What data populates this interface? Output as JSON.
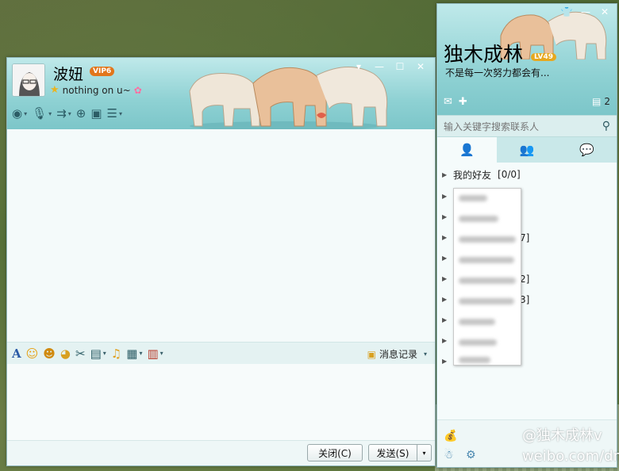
{
  "chat_window": {
    "contact_name": "波妞",
    "vip_badge": "VIP6",
    "status_text": "nothing on u~",
    "window_controls": {
      "menu": "▾",
      "minimize": "—",
      "maximize": "☐",
      "close": "✕"
    },
    "toolbar_icons": [
      "video-call-icon",
      "voice-call-icon",
      "file-transfer-icon",
      "add-contact-icon",
      "screen-share-icon",
      "apps-icon"
    ],
    "format_icons": [
      "font-icon",
      "emoji-icon",
      "magic-emoji-icon",
      "shake-icon",
      "screenshot-icon",
      "image-icon",
      "music-icon",
      "screen-capture-icon",
      "gift-icon"
    ],
    "history_label": "消息记录",
    "close_button": "关闭(C)",
    "send_button": "发送(S)"
  },
  "main_panel": {
    "user_name": "独木成林",
    "level_badge": "LV49",
    "signature": "不是每一次努力都会有...",
    "unread_count": "2",
    "search_placeholder": "输入关键字搜索联系人",
    "tabs": [
      "contacts-tab",
      "groups-tab",
      "recent-tab"
    ],
    "groups": [
      {
        "name": "我的好友",
        "count": "[0/0]"
      }
    ],
    "partial_counts": [
      "7]",
      "2]",
      "3]"
    ]
  },
  "watermark": {
    "line1": "@独木成林v",
    "line2": "weibo.com/dmc"
  },
  "colors": {
    "accent": "#8ed1d3",
    "border": "#8fb7bb",
    "badge_vip": "#e2761b",
    "badge_lv": "#e6a81f"
  }
}
